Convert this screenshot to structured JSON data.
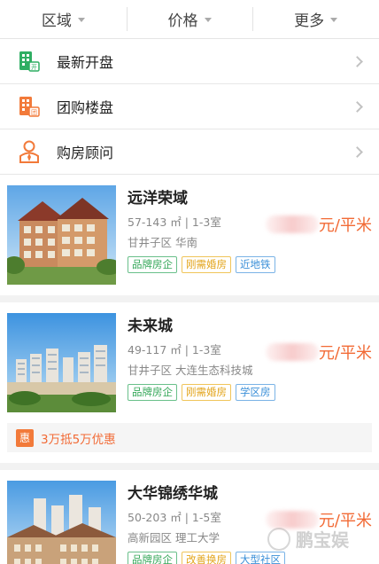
{
  "filters": [
    {
      "label": "区域"
    },
    {
      "label": "价格"
    },
    {
      "label": "更多"
    }
  ],
  "menu": [
    {
      "label": "最新开盘",
      "icon": "building-new-icon"
    },
    {
      "label": "团购楼盘",
      "icon": "building-group-icon"
    },
    {
      "label": "购房顾问",
      "icon": "consultant-icon"
    }
  ],
  "listings": [
    {
      "title": "远洋荣域",
      "meta": "57-143 ㎡ | 1-3室",
      "address": "甘井子区 华南",
      "price_suffix": "元/平米",
      "tags": [
        {
          "label": "品牌房企",
          "color": "green"
        },
        {
          "label": "刚需婚房",
          "color": "yellow"
        },
        {
          "label": "近地铁",
          "color": "blue"
        }
      ]
    },
    {
      "title": "未来城",
      "meta": "49-117 ㎡ | 1-3室",
      "address": "甘井子区 大连生态科技城",
      "price_suffix": "元/平米",
      "tags": [
        {
          "label": "品牌房企",
          "color": "green"
        },
        {
          "label": "刚需婚房",
          "color": "yellow"
        },
        {
          "label": "学区房",
          "color": "blue"
        }
      ],
      "promo": {
        "badge": "惠",
        "text": "3万抵5万优惠"
      }
    },
    {
      "title": "大华锦绣华城",
      "meta": "50-203 ㎡ | 1-5室",
      "address": "高新园区 理工大学",
      "price_suffix": "元/平米",
      "tags": [
        {
          "label": "品牌房企",
          "color": "green"
        },
        {
          "label": "改善换房",
          "color": "yellow"
        },
        {
          "label": "大型社区",
          "color": "blue"
        }
      ]
    }
  ],
  "watermark": "鹏宝娱",
  "colors": {
    "accent": "#f26a35",
    "green_icon": "#2fae63",
    "orange_icon": "#f27a3a"
  }
}
